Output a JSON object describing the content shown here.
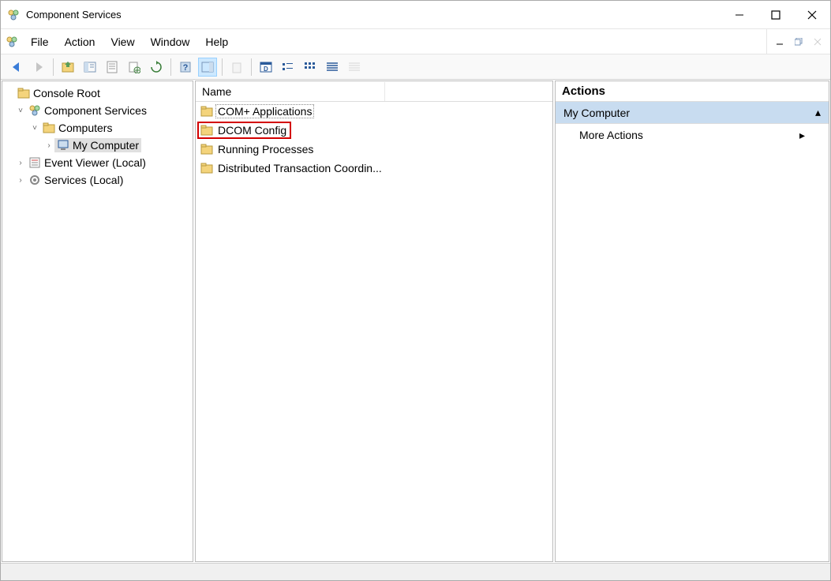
{
  "window": {
    "title": "Component Services"
  },
  "menu": {
    "items": [
      "File",
      "Action",
      "View",
      "Window",
      "Help"
    ]
  },
  "tree": {
    "root": {
      "label": "Console Root",
      "children": [
        {
          "label": "Component Services",
          "expanded": true,
          "children": [
            {
              "label": "Computers",
              "expanded": true,
              "children": [
                {
                  "label": "My Computer",
                  "expanded": false,
                  "selected": true
                }
              ]
            }
          ]
        },
        {
          "label": "Event Viewer (Local)",
          "expanded": false
        },
        {
          "label": "Services (Local)",
          "expanded": false
        }
      ]
    }
  },
  "list": {
    "header": "Name",
    "items": [
      {
        "label": "COM+ Applications",
        "focused": true
      },
      {
        "label": "DCOM Config",
        "highlighted": true
      },
      {
        "label": "Running Processes"
      },
      {
        "label": "Distributed Transaction Coordin..."
      }
    ]
  },
  "actions": {
    "header": "Actions",
    "section": "My Computer",
    "more": "More Actions"
  }
}
